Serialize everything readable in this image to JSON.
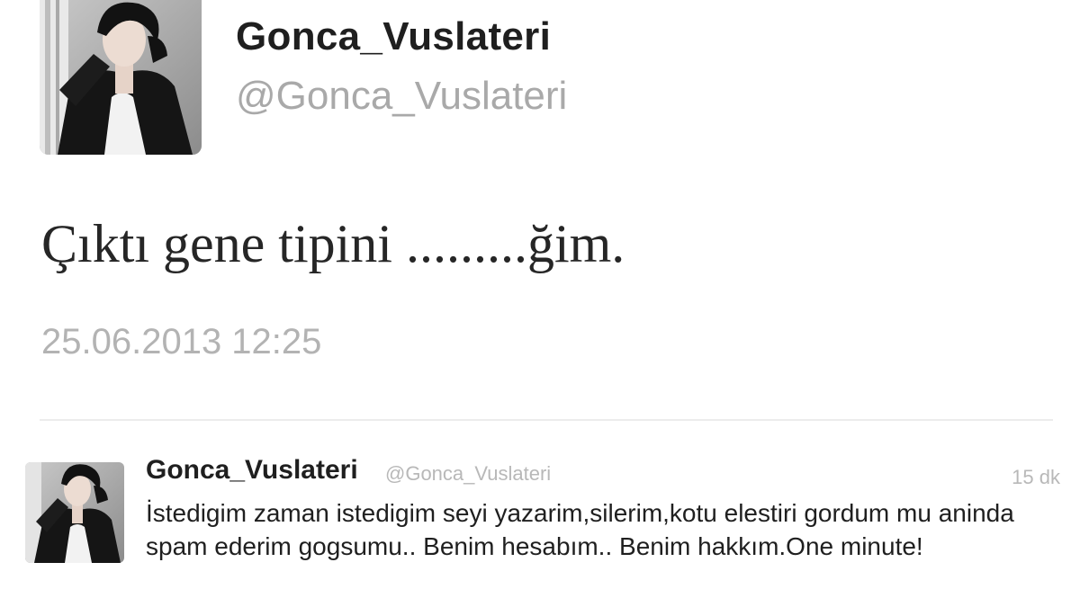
{
  "main_tweet": {
    "display_name": "Gonca_Vuslateri",
    "handle": "@Gonca_Vuslateri",
    "text": "Çıktı gene tipini .........ğim.",
    "timestamp": "25.06.2013 12:25"
  },
  "reply_tweet": {
    "display_name": "Gonca_Vuslateri",
    "handle": "@Gonca_Vuslateri",
    "time_ago": "15 dk",
    "text": "İstedigim zaman istedigim seyi yazarim,silerim,kotu elestiri gordum mu aninda spam ederim gogsumu.. Benim hesabım.. Benim hakkım.One minute!"
  }
}
